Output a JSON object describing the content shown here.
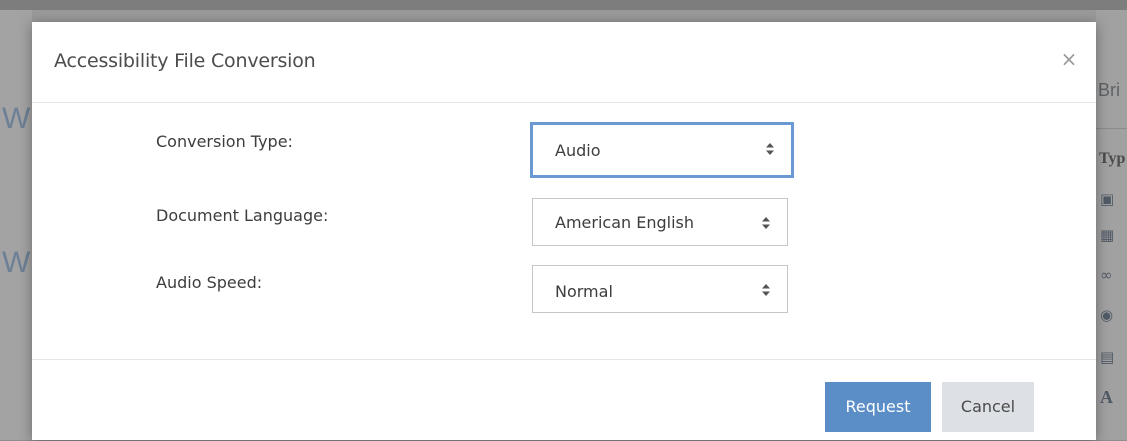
{
  "background": {
    "left_letters": [
      "W",
      "W"
    ],
    "right_text_1": "Bri",
    "right_text_2": "Typ",
    "right_letter": "A"
  },
  "modal": {
    "title": "Accessibility File Conversion",
    "close_label": "×",
    "fields": [
      {
        "label": "Conversion Type:",
        "value": "Audio",
        "focused": true
      },
      {
        "label": "Document Language:",
        "value": "American English",
        "focused": false
      },
      {
        "label": "Audio Speed:",
        "value": "Normal",
        "focused": false
      }
    ],
    "buttons": {
      "request_label": "Request",
      "cancel_label": "Cancel"
    }
  },
  "colors": {
    "primary": "#5b8ec7",
    "focus_border": "#6a9ad1",
    "secondary": "#dde1e6"
  }
}
